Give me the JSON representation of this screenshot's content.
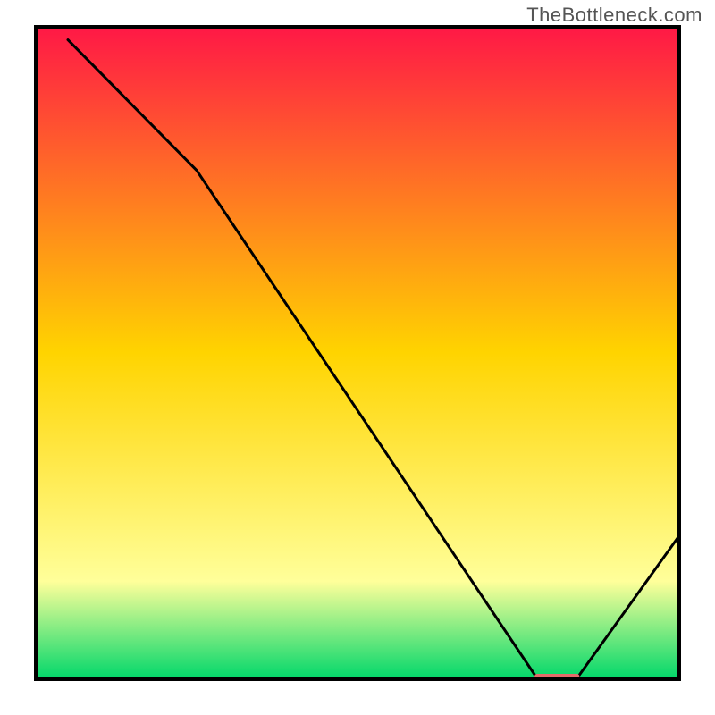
{
  "watermark": "TheBottleneck.com",
  "chart_data": {
    "type": "line",
    "title": "",
    "xlabel": "",
    "ylabel": "",
    "xlim": [
      0,
      100
    ],
    "ylim": [
      0,
      100
    ],
    "grid": false,
    "legend": false,
    "series": [
      {
        "name": "curve",
        "x": [
          5,
          25,
          78,
          84,
          100
        ],
        "y": [
          98,
          78,
          0,
          0,
          22
        ]
      }
    ],
    "marker": {
      "name": "optimal-zone",
      "x0": 77.5,
      "x1": 84.5,
      "y": 0
    },
    "background_gradient": {
      "top_color": "#ff1846",
      "mid_color": "#ffd400",
      "low_color": "#ffff9a",
      "bottom_color": "#00d76a"
    },
    "frame": true
  }
}
